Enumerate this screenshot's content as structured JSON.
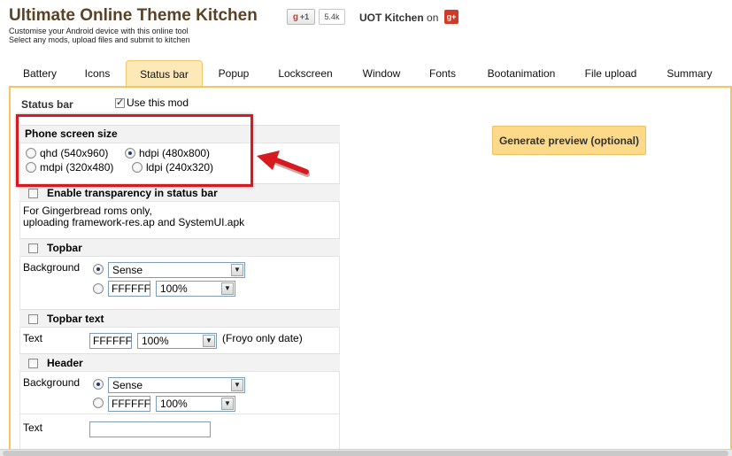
{
  "header": {
    "title": "Ultimate Online Theme Kitchen",
    "tagline_line1": "Customise your Android device with this online tool",
    "tagline_line2": "Select any mods, upload files and submit to kitchen",
    "gplus_label": "+1",
    "gplus_count": "5.4k",
    "uot_kitchen": "UOT Kitchen",
    "on_text": "on"
  },
  "tabs": [
    {
      "label": "Battery"
    },
    {
      "label": "Icons"
    },
    {
      "label": "Status bar"
    },
    {
      "label": "Popup"
    },
    {
      "label": "Lockscreen"
    },
    {
      "label": "Window"
    },
    {
      "label": "Fonts"
    },
    {
      "label": "Bootanimation"
    },
    {
      "label": "File upload"
    },
    {
      "label": "Summary"
    }
  ],
  "active_tab": "Status bar",
  "panel": {
    "section_label": "Status bar",
    "use_mod_label": "Use this mod",
    "use_mod_checked": true,
    "generate_button": "Generate preview (optional)"
  },
  "screen_size": {
    "heading": "Phone screen size",
    "options": [
      {
        "label": "qhd (540x960)",
        "checked": false
      },
      {
        "label": "hdpi (480x800)",
        "checked": true
      },
      {
        "label": "mdpi (320x480)",
        "checked": false
      },
      {
        "label": "ldpi (240x320)",
        "checked": false
      }
    ]
  },
  "transparency": {
    "heading": "Enable transparency in status bar",
    "note_line1": "For Gingerbread roms only,",
    "note_line2": "uploading framework-res.ap and SystemUI.apk"
  },
  "topbar": {
    "heading": "Topbar",
    "background_label": "Background",
    "bg_select": "Sense",
    "color_value": "FFFFFF",
    "opacity_select": "100%"
  },
  "topbar_text": {
    "heading": "Topbar text",
    "text_label": "Text",
    "color_value": "FFFFFF",
    "opacity_select": "100%",
    "note": "(Froyo only date)"
  },
  "header_section": {
    "heading": "Header",
    "background_label": "Background",
    "bg_select": "Sense",
    "color_value": "FFFFFF",
    "opacity_select": "100%",
    "text_label": "Text",
    "text_value": ""
  },
  "colors": {
    "title": "#5a4225",
    "tab_active_bg": "#fde9b8",
    "panel_border": "#f8c462",
    "highlight": "#d71920",
    "button_bg": "#fdd98a"
  }
}
